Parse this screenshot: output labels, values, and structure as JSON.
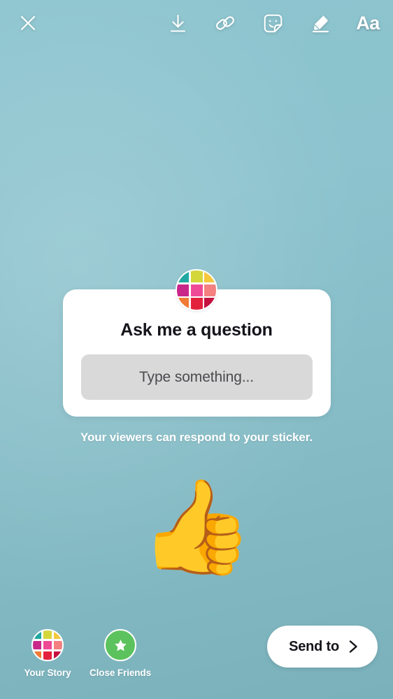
{
  "screen": {
    "background_top_color": "#8dc5cf",
    "background_bottom_color": "#7ab1bb"
  },
  "topbar": {
    "close_label": "close-icon",
    "actions": [
      {
        "name": "save-icon",
        "label": "Save"
      },
      {
        "name": "link-icon",
        "label": "Link"
      },
      {
        "name": "sticker-icon",
        "label": "Stickers"
      },
      {
        "name": "draw-icon",
        "label": "Draw"
      },
      {
        "name": "text-icon",
        "label": "Aa"
      }
    ]
  },
  "sticker": {
    "title": "Ask me a question",
    "answer_placeholder": "Type something...",
    "hint": "Your viewers can respond to your sticker.",
    "avatar_colors": [
      "#1fa9a2",
      "#d4d73a",
      "#f5c73c",
      "#c9268a",
      "#ef4a96",
      "#f4807f",
      "#f07b35",
      "#e4213c",
      "#c51140"
    ]
  },
  "emoji_sticker": {
    "glyph": "👍",
    "name": "thumbs-up-emoji"
  },
  "bottombar": {
    "audiences": [
      {
        "label": "Your Story",
        "icon": "story-grid-avatar"
      },
      {
        "label": "Close Friends",
        "icon": "star-icon",
        "color": "#5cc25d"
      }
    ],
    "send_to_label": "Send to",
    "send_to_chevron": "chevron-right-icon"
  }
}
